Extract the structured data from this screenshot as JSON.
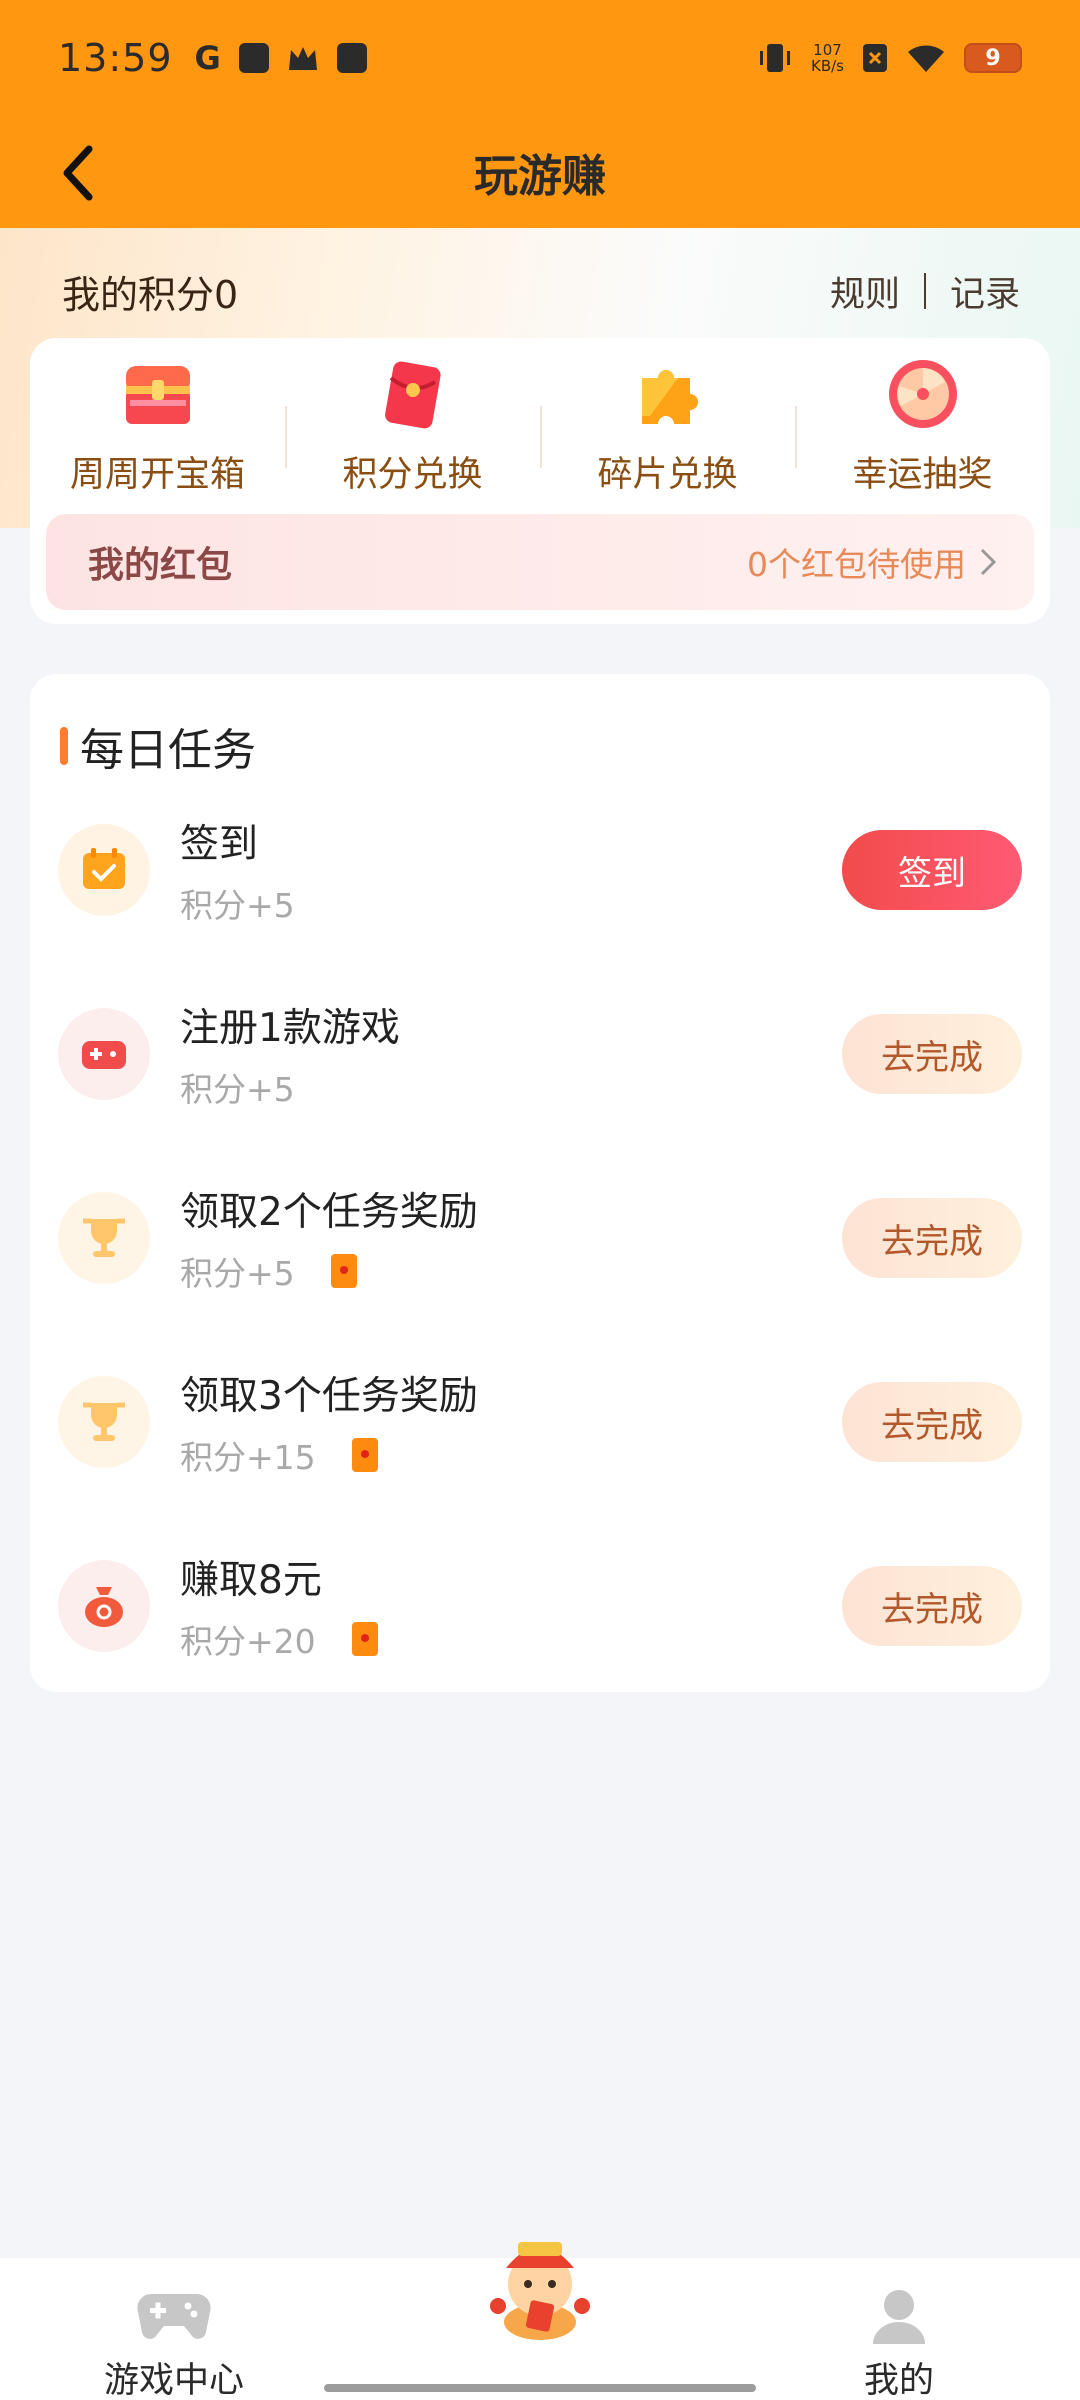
{
  "status_bar": {
    "time": "13:59",
    "network_speed": "107",
    "network_unit": "KB/s",
    "battery": "9"
  },
  "header": {
    "title": "玩游赚"
  },
  "points": {
    "label": "我的积分0",
    "rules_link": "规则",
    "records_link": "记录"
  },
  "quick_actions": [
    {
      "label": "周周开宝箱",
      "icon": "treasure-chest-icon"
    },
    {
      "label": "积分兑换",
      "icon": "red-envelope-icon"
    },
    {
      "label": "碎片兑换",
      "icon": "puzzle-piece-icon"
    },
    {
      "label": "幸运抽奖",
      "icon": "lucky-wheel-icon"
    }
  ],
  "red_packet": {
    "title": "我的红包",
    "status": "0个红包待使用"
  },
  "daily_tasks": {
    "title": "每日任务",
    "items": [
      {
        "name": "签到",
        "reward": "积分+5",
        "button": "签到",
        "icon": "calendar-check-icon",
        "has_coupon": false
      },
      {
        "name": "注册1款游戏",
        "reward": "积分+5",
        "button": "去完成",
        "icon": "gamepad-icon",
        "has_coupon": false
      },
      {
        "name": "领取2个任务奖励",
        "reward": "积分+5",
        "button": "去完成",
        "icon": "trophy-icon",
        "has_coupon": true
      },
      {
        "name": "领取3个任务奖励",
        "reward": "积分+15",
        "button": "去完成",
        "icon": "trophy-icon",
        "has_coupon": true
      },
      {
        "name": "赚取8元",
        "reward": "积分+20",
        "button": "去完成",
        "icon": "money-bag-icon",
        "has_coupon": true
      }
    ]
  },
  "bottom_nav": {
    "left": "游戏中心",
    "right": "我的"
  },
  "colors": {
    "header": "#ff9710",
    "primary_button": "#f24b4b",
    "secondary_button_text": "#b2582b"
  }
}
